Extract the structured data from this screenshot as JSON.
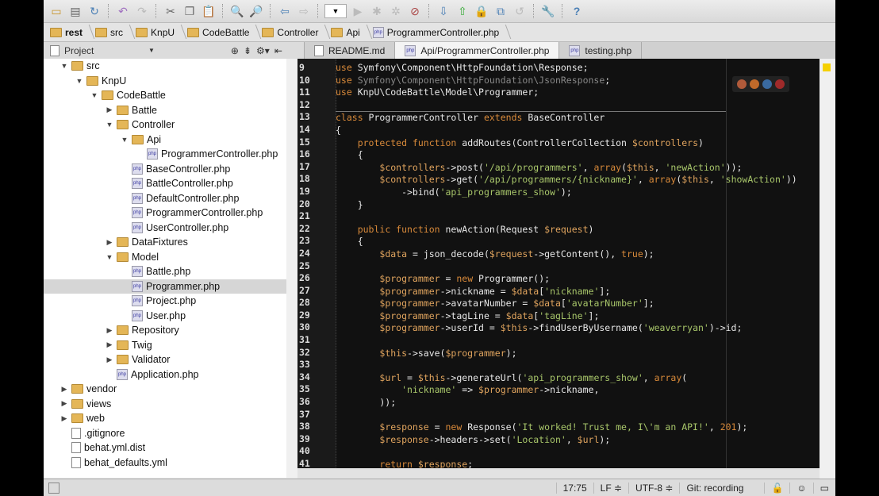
{
  "breadcrumbs": [
    "rest",
    "src",
    "KnpU",
    "CodeBattle",
    "Controller",
    "Api",
    "ProgrammerController.php"
  ],
  "project_panel": {
    "title": "Project"
  },
  "tabs": [
    {
      "label": "README.md",
      "icon": "file"
    },
    {
      "label": "Api/ProgrammerController.php",
      "icon": "php",
      "active": true
    },
    {
      "label": "testing.php",
      "icon": "php"
    }
  ],
  "tree": [
    {
      "d": 1,
      "t": "folder",
      "o": "open",
      "label": "src"
    },
    {
      "d": 2,
      "t": "folder",
      "o": "open",
      "label": "KnpU"
    },
    {
      "d": 3,
      "t": "folder",
      "o": "open",
      "label": "CodeBattle"
    },
    {
      "d": 4,
      "t": "folder",
      "o": "closed",
      "label": "Battle"
    },
    {
      "d": 4,
      "t": "folder",
      "o": "open",
      "label": "Controller"
    },
    {
      "d": 5,
      "t": "folder",
      "o": "open",
      "label": "Api"
    },
    {
      "d": 6,
      "t": "php",
      "label": "ProgrammerController.php"
    },
    {
      "d": 5,
      "t": "php",
      "label": "BaseController.php"
    },
    {
      "d": 5,
      "t": "php",
      "label": "BattleController.php"
    },
    {
      "d": 5,
      "t": "php",
      "label": "DefaultController.php"
    },
    {
      "d": 5,
      "t": "php",
      "label": "ProgrammerController.php"
    },
    {
      "d": 5,
      "t": "php",
      "label": "UserController.php"
    },
    {
      "d": 4,
      "t": "folder",
      "o": "closed",
      "label": "DataFixtures"
    },
    {
      "d": 4,
      "t": "folder",
      "o": "open",
      "label": "Model"
    },
    {
      "d": 5,
      "t": "php",
      "label": "Battle.php"
    },
    {
      "d": 5,
      "t": "php",
      "label": "Programmer.php",
      "sel": true
    },
    {
      "d": 5,
      "t": "php",
      "label": "Project.php"
    },
    {
      "d": 5,
      "t": "php",
      "label": "User.php"
    },
    {
      "d": 4,
      "t": "folder",
      "o": "closed",
      "label": "Repository"
    },
    {
      "d": 4,
      "t": "folder",
      "o": "closed",
      "label": "Twig"
    },
    {
      "d": 4,
      "t": "folder",
      "o": "closed",
      "label": "Validator"
    },
    {
      "d": 4,
      "t": "php",
      "label": "Application.php"
    },
    {
      "d": 1,
      "t": "folder",
      "o": "closed",
      "label": "vendor"
    },
    {
      "d": 1,
      "t": "folder",
      "o": "closed",
      "label": "views"
    },
    {
      "d": 1,
      "t": "folder",
      "o": "closed",
      "label": "web"
    },
    {
      "d": 1,
      "t": "file",
      "label": ".gitignore"
    },
    {
      "d": 1,
      "t": "file",
      "label": "behat.yml.dist"
    },
    {
      "d": 1,
      "t": "file",
      "label": "behat_defaults.yml"
    }
  ],
  "code_start_line": 9,
  "code": [
    [
      [
        "k",
        "use "
      ],
      [
        "t",
        "Symfony\\Component\\HttpFoundation\\Response;"
      ]
    ],
    [
      [
        "k",
        "use "
      ],
      [
        "g",
        "Symfony\\Component\\HttpFoundation\\JsonResponse"
      ],
      [
        "t",
        ";"
      ]
    ],
    [
      [
        "k",
        "use "
      ],
      [
        "t",
        "KnpU\\CodeBattle\\Model\\Programmer;"
      ]
    ],
    [],
    [
      [
        "k",
        "class "
      ],
      [
        "t",
        "ProgrammerController "
      ],
      [
        "k",
        "extends "
      ],
      [
        "t",
        "BaseController"
      ]
    ],
    [
      [
        "t",
        "{"
      ]
    ],
    [
      [
        "t",
        "    "
      ],
      [
        "k",
        "protected function "
      ],
      [
        "t",
        "addRoutes(ControllerCollection "
      ],
      [
        "v",
        "$controllers"
      ],
      [
        "t",
        ")"
      ]
    ],
    [
      [
        "t",
        "    {"
      ]
    ],
    [
      [
        "t",
        "        "
      ],
      [
        "v",
        "$controllers"
      ],
      [
        "t",
        "->post("
      ],
      [
        "s",
        "'/api/programmers'"
      ],
      [
        "t",
        ", "
      ],
      [
        "k",
        "array"
      ],
      [
        "t",
        "("
      ],
      [
        "v",
        "$this"
      ],
      [
        "t",
        ", "
      ],
      [
        "s",
        "'newAction'"
      ],
      [
        "t",
        "));"
      ]
    ],
    [
      [
        "t",
        "        "
      ],
      [
        "v",
        "$controllers"
      ],
      [
        "t",
        "->get("
      ],
      [
        "s",
        "'/api/programmers/{nickname}'"
      ],
      [
        "t",
        ", "
      ],
      [
        "k",
        "array"
      ],
      [
        "t",
        "("
      ],
      [
        "v",
        "$this"
      ],
      [
        "t",
        ", "
      ],
      [
        "s",
        "'showAction'"
      ],
      [
        "t",
        "))"
      ]
    ],
    [
      [
        "t",
        "            ->bind("
      ],
      [
        "s",
        "'api_programmers_show'"
      ],
      [
        "t",
        ");"
      ]
    ],
    [
      [
        "t",
        "    }"
      ]
    ],
    [],
    [
      [
        "t",
        "    "
      ],
      [
        "k",
        "public function "
      ],
      [
        "t",
        "newAction(Request "
      ],
      [
        "v",
        "$request"
      ],
      [
        "t",
        ")"
      ]
    ],
    [
      [
        "t",
        "    {"
      ]
    ],
    [
      [
        "t",
        "        "
      ],
      [
        "v",
        "$data"
      ],
      [
        "t",
        " = json_decode("
      ],
      [
        "v",
        "$request"
      ],
      [
        "t",
        "->getContent(), "
      ],
      [
        "k",
        "true"
      ],
      [
        "t",
        ");"
      ]
    ],
    [],
    [
      [
        "t",
        "        "
      ],
      [
        "v",
        "$programmer"
      ],
      [
        "t",
        " = "
      ],
      [
        "k",
        "new "
      ],
      [
        "t",
        "Programmer();"
      ]
    ],
    [
      [
        "t",
        "        "
      ],
      [
        "v",
        "$programmer"
      ],
      [
        "t",
        "->nickname = "
      ],
      [
        "v",
        "$data"
      ],
      [
        "t",
        "["
      ],
      [
        "s",
        "'nickname'"
      ],
      [
        "t",
        "];"
      ]
    ],
    [
      [
        "t",
        "        "
      ],
      [
        "v",
        "$programmer"
      ],
      [
        "t",
        "->avatarNumber = "
      ],
      [
        "v",
        "$data"
      ],
      [
        "t",
        "["
      ],
      [
        "s",
        "'avatarNumber'"
      ],
      [
        "t",
        "];"
      ]
    ],
    [
      [
        "t",
        "        "
      ],
      [
        "v",
        "$programmer"
      ],
      [
        "t",
        "->tagLine = "
      ],
      [
        "v",
        "$data"
      ],
      [
        "t",
        "["
      ],
      [
        "s",
        "'tagLine'"
      ],
      [
        "t",
        "];"
      ]
    ],
    [
      [
        "t",
        "        "
      ],
      [
        "v",
        "$programmer"
      ],
      [
        "t",
        "->userId = "
      ],
      [
        "v",
        "$this"
      ],
      [
        "t",
        "->findUserByUsername("
      ],
      [
        "s",
        "'weaverryan'"
      ],
      [
        "t",
        ")->id;"
      ]
    ],
    [],
    [
      [
        "t",
        "        "
      ],
      [
        "v",
        "$this"
      ],
      [
        "t",
        "->save("
      ],
      [
        "v",
        "$programmer"
      ],
      [
        "t",
        ");"
      ]
    ],
    [],
    [
      [
        "t",
        "        "
      ],
      [
        "v",
        "$url"
      ],
      [
        "t",
        " = "
      ],
      [
        "v",
        "$this"
      ],
      [
        "t",
        "->generateUrl("
      ],
      [
        "s",
        "'api_programmers_show'"
      ],
      [
        "t",
        ", "
      ],
      [
        "k",
        "array"
      ],
      [
        "t",
        "("
      ]
    ],
    [
      [
        "t",
        "            "
      ],
      [
        "s",
        "'nickname'"
      ],
      [
        "t",
        " => "
      ],
      [
        "v",
        "$programmer"
      ],
      [
        "t",
        "->nickname,"
      ]
    ],
    [
      [
        "t",
        "        ));"
      ]
    ],
    [],
    [
      [
        "t",
        "        "
      ],
      [
        "v",
        "$response"
      ],
      [
        "t",
        " = "
      ],
      [
        "k",
        "new "
      ],
      [
        "t",
        "Response("
      ],
      [
        "s",
        "'It worked! Trust me, I\\'m an API!'"
      ],
      [
        "t",
        ", "
      ],
      [
        "k",
        "201"
      ],
      [
        "t",
        ");"
      ]
    ],
    [
      [
        "t",
        "        "
      ],
      [
        "v",
        "$response"
      ],
      [
        "t",
        "->headers->set("
      ],
      [
        "s",
        "'Location'"
      ],
      [
        "t",
        ", "
      ],
      [
        "v",
        "$url"
      ],
      [
        "t",
        ");"
      ]
    ],
    [],
    [
      [
        "t",
        "        "
      ],
      [
        "k",
        "return "
      ],
      [
        "v",
        "$response"
      ],
      [
        "t",
        ";"
      ]
    ]
  ],
  "status": {
    "position": "17:75",
    "line_sep": "LF ≑",
    "encoding": "UTF-8 ≑",
    "vcs": "Git: recording"
  }
}
